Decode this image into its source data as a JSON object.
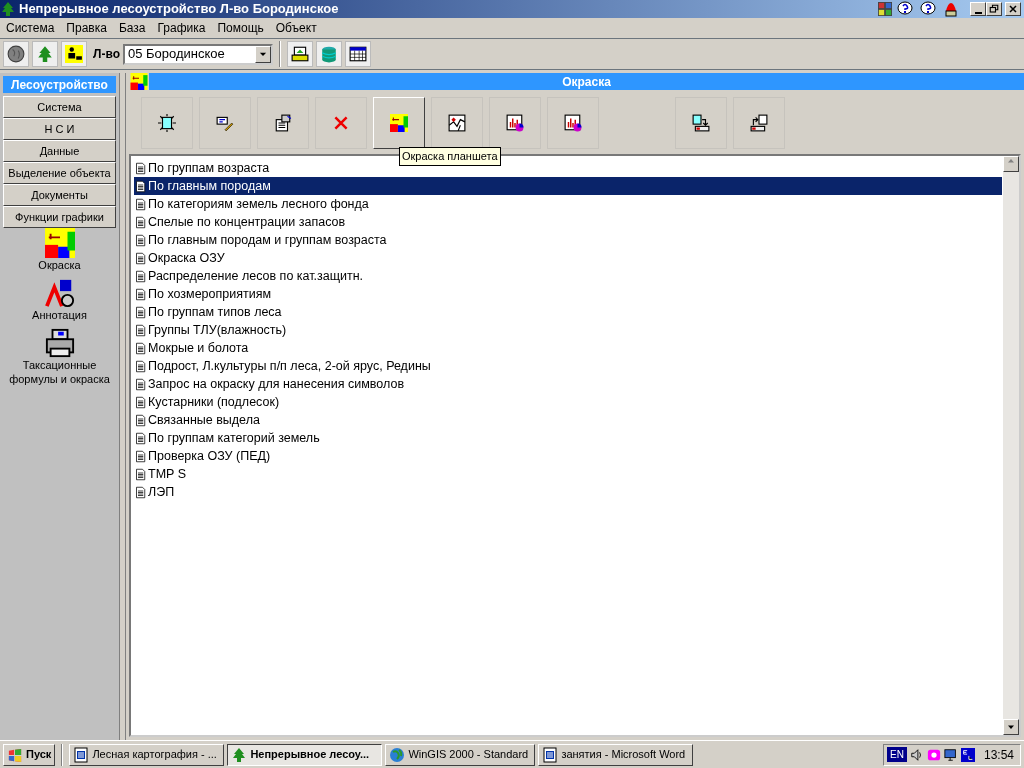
{
  "window": {
    "title": "Непрерывное лесоустройство  Л-во Бородинское"
  },
  "menu": [
    "Система",
    "Правка",
    "База",
    "Графика",
    "Помощь",
    "Объект"
  ],
  "toolbar": {
    "label": "Л-во",
    "dropdown": {
      "value": "05 Бородинское"
    }
  },
  "sidebar": {
    "title": "Лесоустройство",
    "buttons": [
      "Система",
      "Н С И",
      "Данные",
      "Выделение объекта",
      "Документы",
      "Функции графики"
    ],
    "items": [
      {
        "kind": "paint",
        "label": "Окраска"
      },
      {
        "kind": "annotation",
        "label": "Аннотация"
      },
      {
        "kind": "printer",
        "label": "Таксационные формулы и окраска"
      }
    ]
  },
  "panel": {
    "title": "Окраска",
    "tools": [
      {
        "kind": "new",
        "selected": false,
        "separated": false
      },
      {
        "kind": "edit",
        "selected": false,
        "separated": false
      },
      {
        "kind": "properties",
        "selected": false,
        "separated": false
      },
      {
        "kind": "delete",
        "selected": false,
        "separated": false
      },
      {
        "kind": "paint",
        "selected": true,
        "separated": false
      },
      {
        "kind": "map",
        "selected": false,
        "separated": false
      },
      {
        "kind": "chart",
        "selected": false,
        "separated": false
      },
      {
        "kind": "chart",
        "selected": false,
        "separated": false
      },
      {
        "kind": "import",
        "selected": false,
        "separated": true
      },
      {
        "kind": "export",
        "selected": false,
        "separated": false
      }
    ],
    "tooltip": "Окраска планшета",
    "items": [
      {
        "label": "По группам возраста",
        "selected": false
      },
      {
        "label": "По главным породам",
        "selected": true
      },
      {
        "label": "По категориям земель лесного фонда",
        "selected": false
      },
      {
        "label": "Спелые по концентрации запасов",
        "selected": false
      },
      {
        "label": "По главным породам и группам возраста",
        "selected": false
      },
      {
        "label": "Окраска ОЗУ",
        "selected": false
      },
      {
        "label": "Распределение лесов по кат.защитн.",
        "selected": false
      },
      {
        "label": "По хозмероприятиям",
        "selected": false
      },
      {
        "label": "По группам типов леса",
        "selected": false
      },
      {
        "label": "Группы ТЛУ(влажность)",
        "selected": false
      },
      {
        "label": "Мокрые и болота",
        "selected": false
      },
      {
        "label": "Подрост, Л.культуры п/п леса, 2-ой ярус, Редины",
        "selected": false
      },
      {
        "label": "Запрос на окраску для нанесения символов",
        "selected": false
      },
      {
        "label": "Кустарники (подлесок)",
        "selected": false
      },
      {
        "label": "Связанные выдела",
        "selected": false
      },
      {
        "label": "По группам категорий земель",
        "selected": false
      },
      {
        "label": "Проверка ОЗУ (ПЕД)",
        "selected": false
      },
      {
        "label": "TMP S",
        "selected": false
      },
      {
        "label": "ЛЭП",
        "selected": false
      }
    ]
  },
  "taskbar": {
    "start": "Пуск",
    "tasks": [
      {
        "kind": "word",
        "label": "Лесная картография - ...",
        "selected": false
      },
      {
        "kind": "tree",
        "label": "Непрерывное лесоу...",
        "selected": true
      },
      {
        "kind": "globe",
        "label": "WinGIS 2000 - Standard",
        "selected": false
      },
      {
        "kind": "word",
        "label": "занятия - Microsoft Word",
        "selected": false
      }
    ],
    "language": "EN",
    "clock": "13:54"
  }
}
